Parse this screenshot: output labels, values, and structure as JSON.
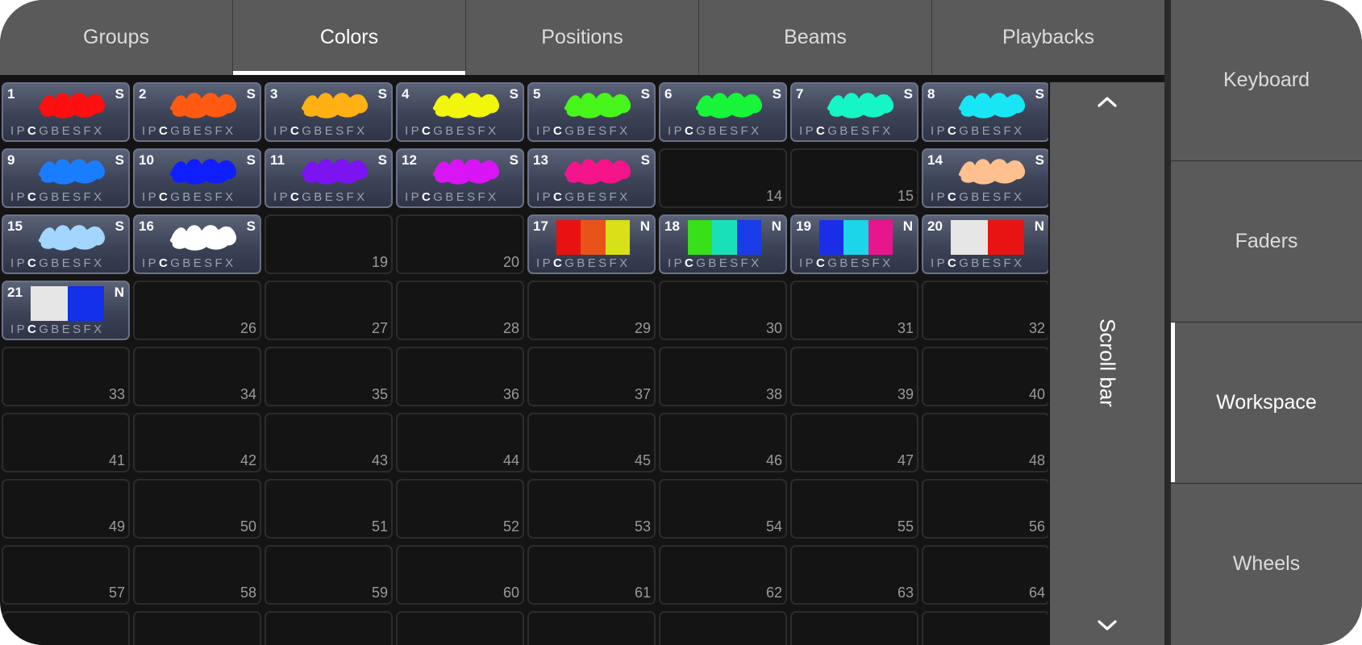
{
  "tabs": [
    {
      "label": "Groups",
      "active": false
    },
    {
      "label": "Colors",
      "active": true
    },
    {
      "label": "Positions",
      "active": false
    },
    {
      "label": "Beams",
      "active": false
    },
    {
      "label": "Playbacks",
      "active": false
    }
  ],
  "side_menu": [
    {
      "label": "Keyboard",
      "active": false
    },
    {
      "label": "Faders",
      "active": false
    },
    {
      "label": "Workspace",
      "active": true
    },
    {
      "label": "Wheels",
      "active": false
    }
  ],
  "scrollbar": {
    "label": "Scroll bar",
    "up_icon": "chevron-up-icon",
    "down_icon": "chevron-down-icon"
  },
  "attr_letters": [
    "I",
    "P",
    "C",
    "G",
    "B",
    "E",
    "S",
    "FX"
  ],
  "active_attr": "C",
  "grid_columns": 8,
  "grid_total_cells": 72,
  "presets": [
    {
      "slot": 1,
      "num": "1",
      "flag": "S",
      "type": "scribble",
      "color": "#ff0f0f"
    },
    {
      "slot": 2,
      "num": "2",
      "flag": "S",
      "type": "scribble",
      "color": "#ff5a12"
    },
    {
      "slot": 3,
      "num": "3",
      "flag": "S",
      "type": "scribble",
      "color": "#ffb012"
    },
    {
      "slot": 4,
      "num": "4",
      "flag": "S",
      "type": "scribble",
      "color": "#f2f50c"
    },
    {
      "slot": 5,
      "num": "5",
      "flag": "S",
      "type": "scribble",
      "color": "#47f51a"
    },
    {
      "slot": 6,
      "num": "6",
      "flag": "S",
      "type": "scribble",
      "color": "#16f53a"
    },
    {
      "slot": 7,
      "num": "7",
      "flag": "S",
      "type": "scribble",
      "color": "#16f5c4"
    },
    {
      "slot": 8,
      "num": "8",
      "flag": "S",
      "type": "scribble",
      "color": "#18e6f5"
    },
    {
      "slot": 9,
      "num": "9",
      "flag": "S",
      "type": "scribble",
      "color": "#1a7cff"
    },
    {
      "slot": 10,
      "num": "10",
      "flag": "S",
      "type": "scribble",
      "color": "#0f1eff"
    },
    {
      "slot": 11,
      "num": "11",
      "flag": "S",
      "type": "scribble",
      "color": "#7b14f0"
    },
    {
      "slot": 12,
      "num": "12",
      "flag": "S",
      "type": "scribble",
      "color": "#d914f5"
    },
    {
      "slot": 13,
      "num": "13",
      "flag": "S",
      "type": "scribble",
      "color": "#f5148a"
    },
    {
      "slot": 16,
      "num": "14",
      "flag": "S",
      "type": "scribble",
      "color": "#ffc08f"
    },
    {
      "slot": 17,
      "num": "15",
      "flag": "S",
      "type": "scribble",
      "color": "#a3d6ff"
    },
    {
      "slot": 18,
      "num": "16",
      "flag": "S",
      "type": "scribble",
      "color": "#ffffff"
    },
    {
      "slot": 21,
      "num": "17",
      "flag": "N",
      "type": "bars",
      "colors": [
        "#e81212",
        "#e8531a",
        "#d8e018"
      ]
    },
    {
      "slot": 22,
      "num": "18",
      "flag": "N",
      "type": "bars",
      "colors": [
        "#38e01a",
        "#1ae0b8",
        "#1a3be8"
      ]
    },
    {
      "slot": 23,
      "num": "19",
      "flag": "N",
      "type": "bars",
      "colors": [
        "#1a2ee8",
        "#1ad6e8",
        "#e8168c"
      ]
    },
    {
      "slot": 24,
      "num": "20",
      "flag": "N",
      "type": "bars",
      "colors": [
        "#e6e6e6",
        "#e81414"
      ]
    },
    {
      "slot": 25,
      "num": "21",
      "flag": "N",
      "type": "bars",
      "colors": [
        "#e6e6e6",
        "#1430e8"
      ]
    }
  ]
}
